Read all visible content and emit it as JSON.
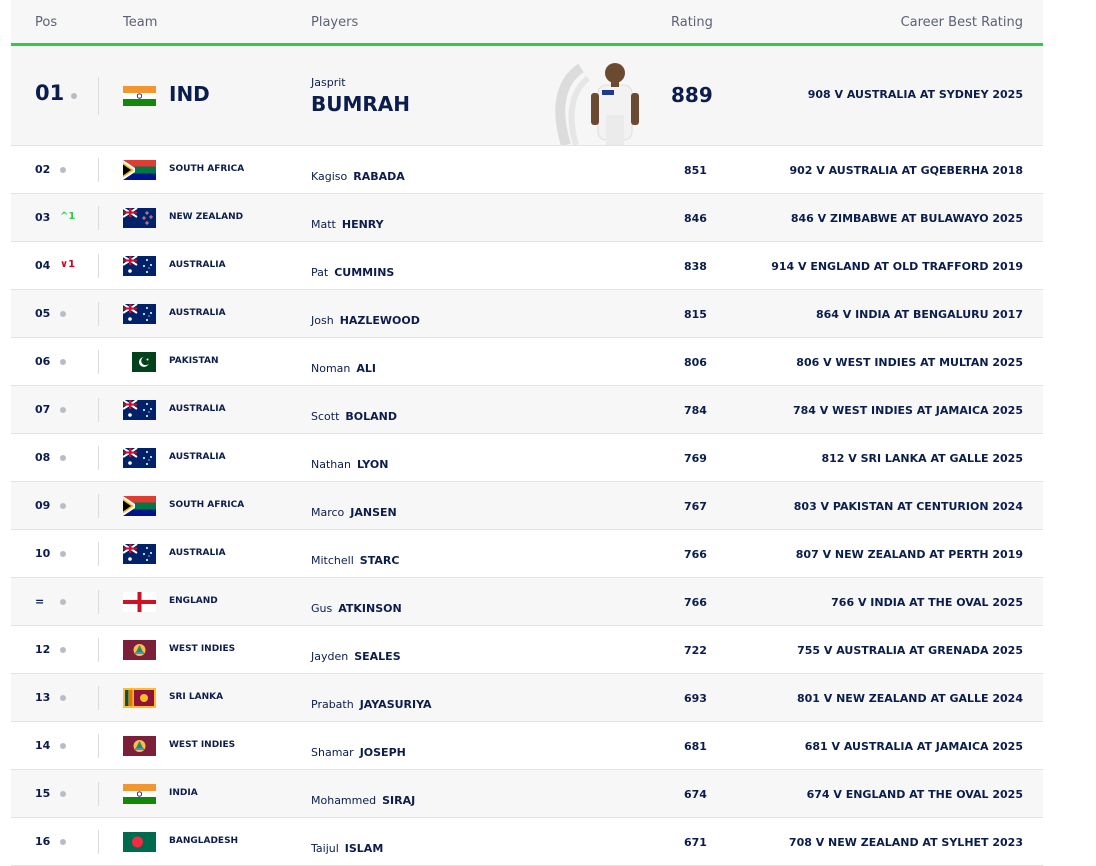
{
  "header": {
    "pos": "Pos",
    "team": "Team",
    "players": "Players",
    "rating": "Rating",
    "best": "Career Best Rating"
  },
  "top": {
    "pos": "01",
    "team": "IND",
    "first": "Jasprit",
    "last": "BUMRAH",
    "rating": "889",
    "best": "908 V AUSTRALIA AT SYDNEY 2025",
    "flag": "india"
  },
  "rows": [
    {
      "pos": "02",
      "move": "",
      "team": "SOUTH AFRICA",
      "flag": "south-africa",
      "first": "Kagiso",
      "last": "RABADA",
      "rating": "851",
      "best": "902 V AUSTRALIA AT GQEBERHA 2018"
    },
    {
      "pos": "03",
      "move": "up",
      "move_value": "1",
      "team": "NEW ZEALAND",
      "flag": "new-zealand",
      "first": "Matt",
      "last": "HENRY",
      "rating": "846",
      "best": "846 V ZIMBABWE AT BULAWAYO 2025"
    },
    {
      "pos": "04",
      "move": "down",
      "move_value": "1",
      "team": "AUSTRALIA",
      "flag": "australia",
      "first": "Pat",
      "last": "CUMMINS",
      "rating": "838",
      "best": "914 V ENGLAND AT OLD TRAFFORD 2019"
    },
    {
      "pos": "05",
      "move": "",
      "team": "AUSTRALIA",
      "flag": "australia",
      "first": "Josh",
      "last": "HAZLEWOOD",
      "rating": "815",
      "best": "864 V INDIA AT BENGALURU 2017"
    },
    {
      "pos": "06",
      "move": "",
      "team": "PAKISTAN",
      "flag": "pakistan",
      "first": "Noman",
      "last": "ALI",
      "rating": "806",
      "best": "806 V WEST INDIES AT MULTAN 2025"
    },
    {
      "pos": "07",
      "move": "",
      "team": "AUSTRALIA",
      "flag": "australia",
      "first": "Scott",
      "last": "BOLAND",
      "rating": "784",
      "best": "784 V WEST INDIES AT JAMAICA 2025"
    },
    {
      "pos": "08",
      "move": "",
      "team": "AUSTRALIA",
      "flag": "australia",
      "first": "Nathan",
      "last": "LYON",
      "rating": "769",
      "best": "812 V SRI LANKA AT GALLE 2025"
    },
    {
      "pos": "09",
      "move": "",
      "team": "SOUTH AFRICA",
      "flag": "south-africa",
      "first": "Marco",
      "last": "JANSEN",
      "rating": "767",
      "best": "803 V PAKISTAN AT CENTURION 2024"
    },
    {
      "pos": "10",
      "move": "",
      "team": "AUSTRALIA",
      "flag": "australia",
      "first": "Mitchell",
      "last": "STARC",
      "rating": "766",
      "best": "807 V NEW ZEALAND AT PERTH 2019"
    },
    {
      "pos": "=",
      "move": "",
      "team": "ENGLAND",
      "flag": "england",
      "first": "Gus",
      "last": "ATKINSON",
      "rating": "766",
      "best": "766 V INDIA AT THE OVAL 2025"
    },
    {
      "pos": "12",
      "move": "",
      "team": "WEST INDIES",
      "flag": "west-indies",
      "first": "Jayden",
      "last": "SEALES",
      "rating": "722",
      "best": "755 V AUSTRALIA AT GRENADA 2025"
    },
    {
      "pos": "13",
      "move": "",
      "team": "SRI LANKA",
      "flag": "sri-lanka",
      "first": "Prabath",
      "last": "JAYASURIYA",
      "rating": "693",
      "best": "801 V NEW ZEALAND AT GALLE 2024"
    },
    {
      "pos": "14",
      "move": "",
      "team": "WEST INDIES",
      "flag": "west-indies",
      "first": "Shamar",
      "last": "JOSEPH",
      "rating": "681",
      "best": "681 V AUSTRALIA AT JAMAICA 2025"
    },
    {
      "pos": "15",
      "move": "",
      "team": "INDIA",
      "flag": "india",
      "first": "Mohammed",
      "last": "SIRAJ",
      "rating": "674",
      "best": "674 V ENGLAND AT THE OVAL 2025"
    },
    {
      "pos": "16",
      "move": "",
      "team": "BANGLADESH",
      "flag": "bangladesh",
      "first": "Taijul",
      "last": "ISLAM",
      "rating": "671",
      "best": "708 V NEW ZEALAND AT SYLHET 2023"
    }
  ],
  "colors": {
    "accent": "#2ecc40",
    "text": "#0b1d4d",
    "up": "#2ecc40",
    "down": "#d0021b"
  }
}
